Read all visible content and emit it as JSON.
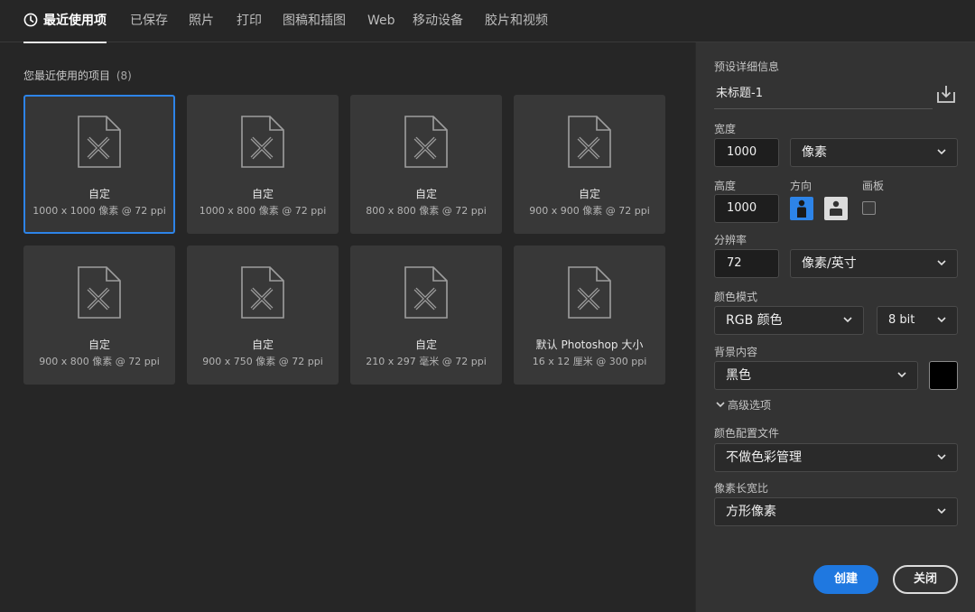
{
  "tabs": [
    {
      "label": "最近使用项",
      "active": true
    },
    {
      "label": "已保存"
    },
    {
      "label": "照片"
    },
    {
      "label": "打印"
    },
    {
      "label": "图稿和插图"
    },
    {
      "label": "Web"
    },
    {
      "label": "移动设备"
    },
    {
      "label": "胶片和视频"
    }
  ],
  "recent": {
    "title": "您最近使用的项目",
    "count": "(8)",
    "items": [
      {
        "name": "自定",
        "size": "1000 x 1000 像素 @ 72 ppi",
        "selected": true
      },
      {
        "name": "自定",
        "size": "1000 x 800 像素 @ 72 ppi"
      },
      {
        "name": "自定",
        "size": "800 x 800 像素 @ 72 ppi"
      },
      {
        "name": "自定",
        "size": "900 x 900 像素 @ 72 ppi"
      },
      {
        "name": "自定",
        "size": "900 x 800 像素 @ 72 ppi"
      },
      {
        "name": "自定",
        "size": "900 x 750 像素 @ 72 ppi"
      },
      {
        "name": "自定",
        "size": "210 x 297 毫米 @ 72 ppi"
      },
      {
        "name": "默认 Photoshop 大小",
        "size": "16 x 12 厘米 @ 300 ppi"
      }
    ]
  },
  "panel": {
    "title": "预设详细信息",
    "doc_name": "未标题-1",
    "width_label": "宽度",
    "width_value": "1000",
    "width_unit": "像素",
    "height_label": "高度",
    "height_value": "1000",
    "orientation_label": "方向",
    "artboard_label": "画板",
    "resolution_label": "分辨率",
    "resolution_value": "72",
    "resolution_unit": "像素/英寸",
    "color_mode_label": "颜色模式",
    "color_mode": "RGB 颜色",
    "bit_depth": "8 bit",
    "background_label": "背景内容",
    "background": "黑色",
    "background_color": "#000000",
    "advanced_label": "高级选项",
    "color_profile_label": "颜色配置文件",
    "color_profile": "不做色彩管理",
    "pixel_aspect_label": "像素长宽比",
    "pixel_aspect": "方形像素",
    "create_label": "创建",
    "close_label": "关闭"
  },
  "colors": {
    "accent": "#2d84e8",
    "background": "#262626",
    "panel": "#333333"
  }
}
